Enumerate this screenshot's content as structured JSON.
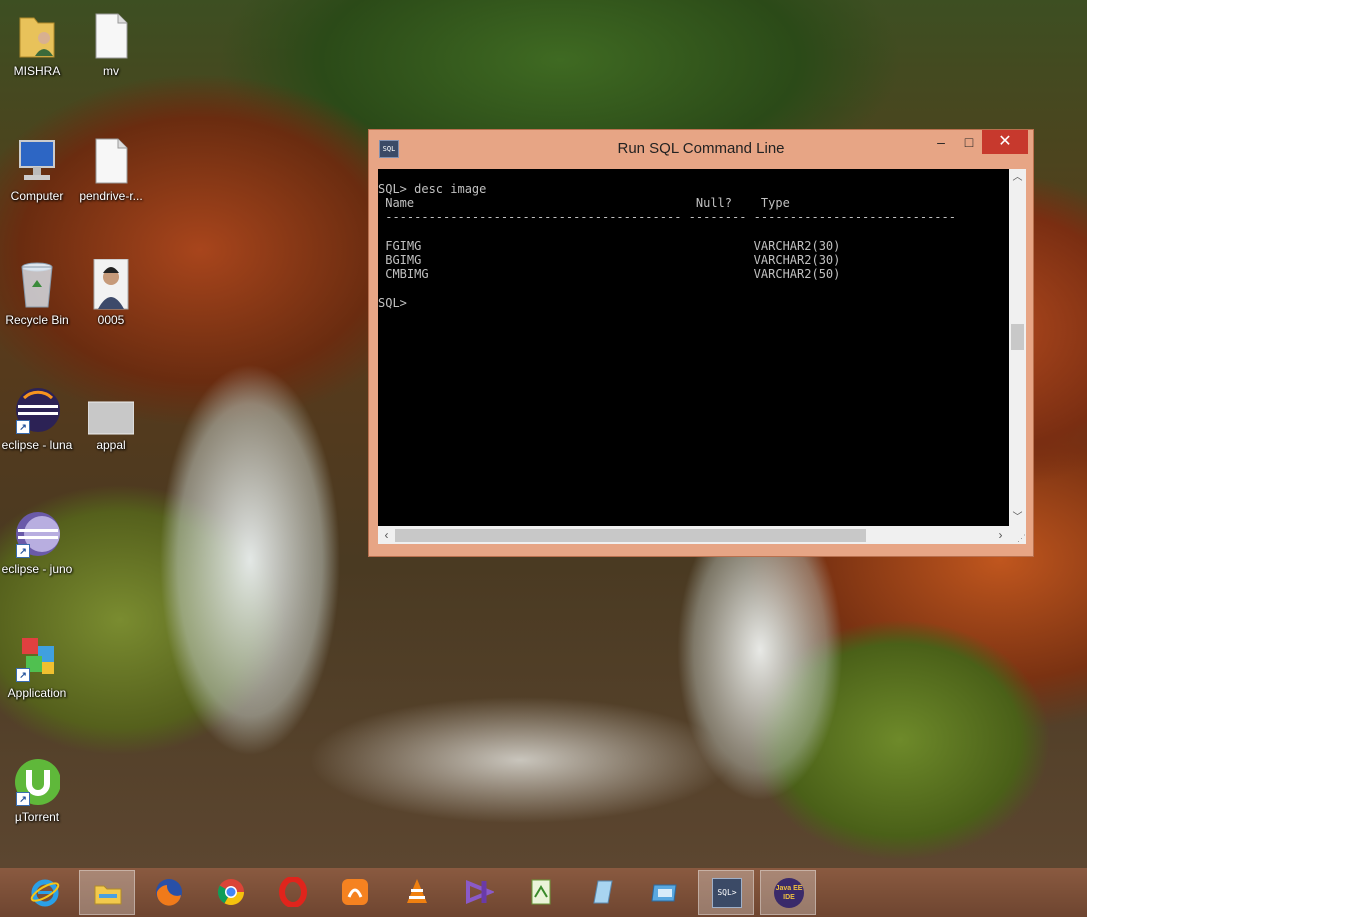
{
  "desktop": {
    "icons": [
      {
        "label": "MISHRA",
        "icon": "user-folder-icon"
      },
      {
        "label": "mv",
        "icon": "text-file-icon"
      },
      {
        "label": "Computer",
        "icon": "computer-icon"
      },
      {
        "label": "pendrive-r...",
        "icon": "text-file-icon"
      },
      {
        "label": "Recycle Bin",
        "icon": "recycle-bin-icon"
      },
      {
        "label": "0005",
        "icon": "photo-icon"
      },
      {
        "label": "eclipse - luna",
        "icon": "eclipse-icon"
      },
      {
        "label": "appal",
        "icon": "image-file-icon"
      },
      {
        "label": "eclipse - juno",
        "icon": "eclipse-icon"
      },
      {
        "label": "Application",
        "icon": "application-icon"
      },
      {
        "label": "µTorrent",
        "icon": "utorrent-icon"
      }
    ]
  },
  "window": {
    "title": "Run SQL Command Line",
    "app_icon_text": "SQL",
    "minimize": "–",
    "maximize": "□",
    "close": "✕",
    "console_text": "SQL> desc image\n Name                                       Null?    Type\n ----------------------------------------- -------- ----------------------------\n\n FGIMG                                              VARCHAR2(30)\n BGIMG                                              VARCHAR2(30)\n CMBIMG                                             VARCHAR2(50)\n\nSQL>"
  },
  "taskbar": {
    "items": [
      {
        "name": "internet-explorer",
        "active": false
      },
      {
        "name": "file-explorer",
        "active": true
      },
      {
        "name": "firefox",
        "active": false
      },
      {
        "name": "chrome",
        "active": false
      },
      {
        "name": "opera",
        "active": false
      },
      {
        "name": "uc-browser",
        "active": false
      },
      {
        "name": "vlc",
        "active": false
      },
      {
        "name": "visual-studio",
        "active": false
      },
      {
        "name": "notepad-plus-plus",
        "active": false
      },
      {
        "name": "notepad",
        "active": false
      },
      {
        "name": "remote-desktop",
        "active": false
      },
      {
        "name": "run-sql-command-line",
        "active": true,
        "icon_text": "SQL>"
      },
      {
        "name": "java-ee-ide",
        "active": true,
        "icon_text": "Java EE IDE"
      }
    ]
  },
  "colors": {
    "window_frame": "#e7a585",
    "close_button": "#c7392d",
    "console_bg": "#000000",
    "console_fg": "#c0c0c0",
    "taskbar": "#7a4c36"
  }
}
